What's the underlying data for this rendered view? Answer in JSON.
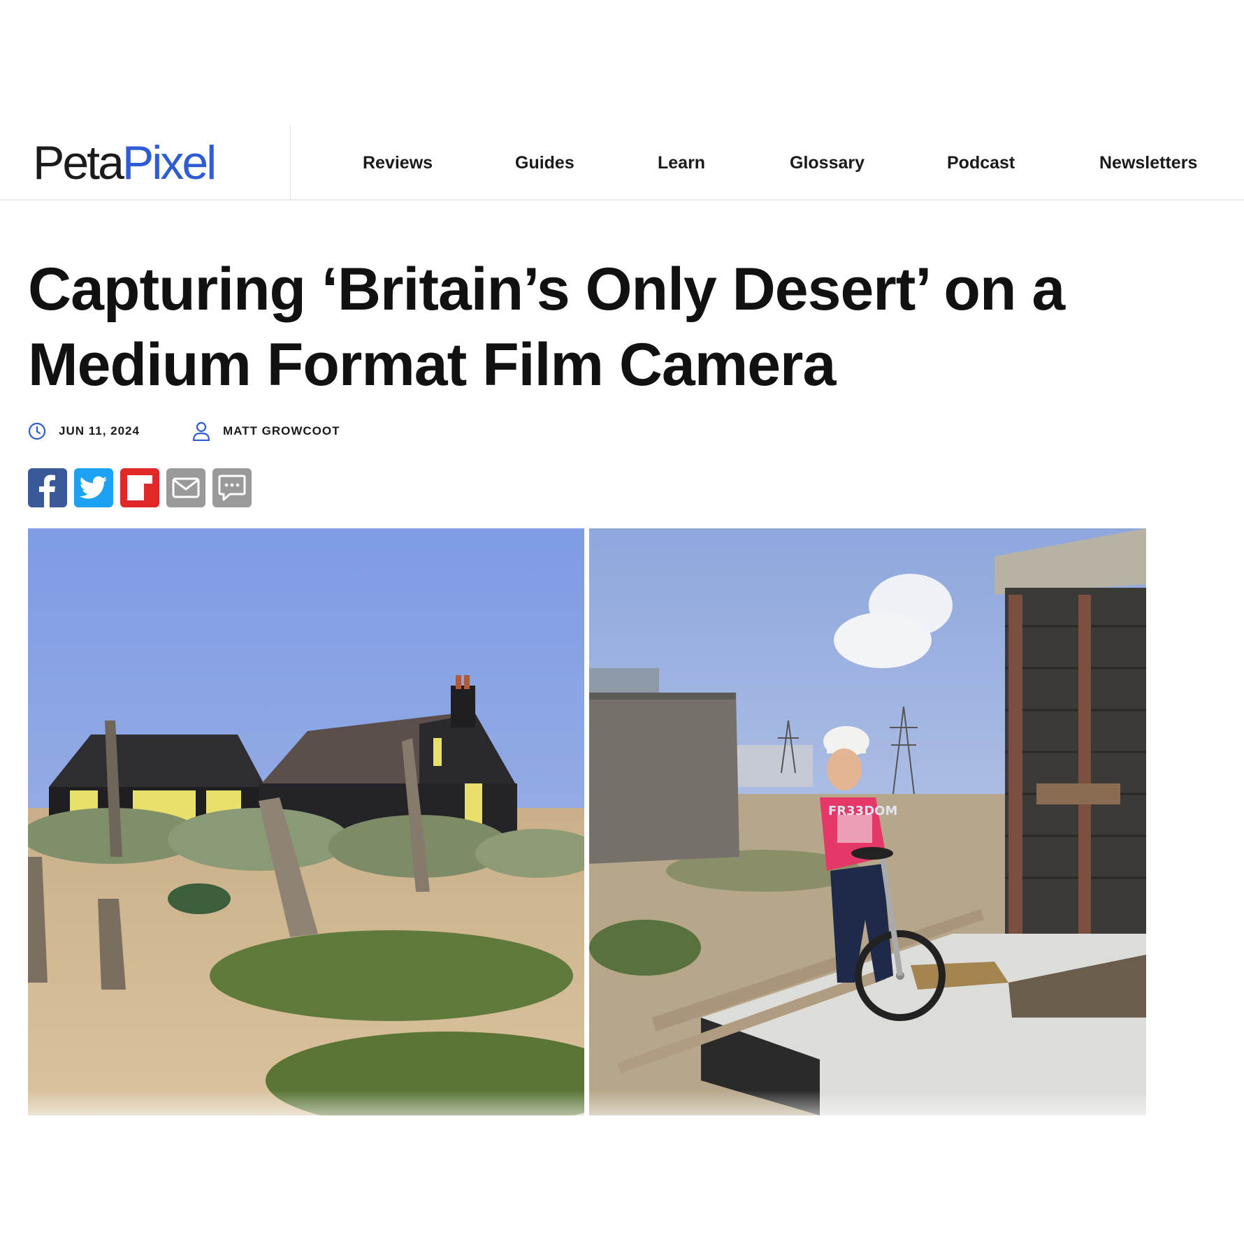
{
  "site": {
    "logo_part1": "Peta",
    "logo_part2": "Pixel",
    "brand_color": "#2f5bd3"
  },
  "nav": {
    "items": [
      {
        "label": "Reviews"
      },
      {
        "label": "Guides"
      },
      {
        "label": "Learn"
      },
      {
        "label": "Glossary"
      },
      {
        "label": "Podcast"
      },
      {
        "label": "Newsletters"
      }
    ]
  },
  "article": {
    "title_line1": "Capturing ‘Britain’s Only Desert’ on a",
    "title_line2": "Medium Format Film Camera",
    "date": "JUN 11, 2024",
    "author": "MATT GROWCOOT"
  },
  "share": {
    "buttons": [
      "facebook-icon",
      "twitter-icon",
      "flipboard-icon",
      "email-icon",
      "comment-icon"
    ]
  },
  "images": {
    "left_shirt_text": "",
    "right_shirt_text": "FR33DOM"
  }
}
